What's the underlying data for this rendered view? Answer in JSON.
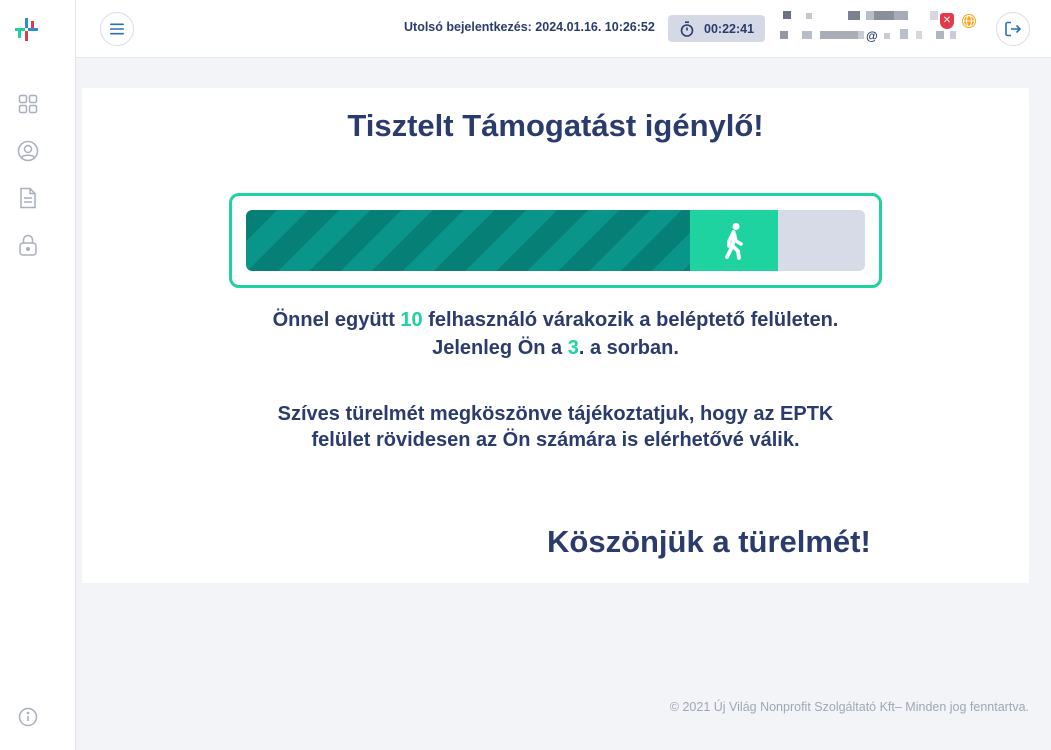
{
  "header": {
    "last_login_label": "Utolsó bejelentkezés: 2024.01.16. 10:26:52",
    "session_timer": "00:22:41",
    "user_email_separator": "@"
  },
  "sidebar": {
    "items": [
      {
        "icon": "dashboard-grid-icon"
      },
      {
        "icon": "user-profile-icon"
      },
      {
        "icon": "document-icon"
      },
      {
        "icon": "lock-icon"
      }
    ],
    "bottom_icon": "info-icon"
  },
  "main": {
    "title": "Tisztelt Támogatást igénylő!",
    "queue": {
      "progress_percent": 86,
      "line1_before": "Önnel együtt ",
      "waiting_count": "10",
      "line1_after": " felhasználó várakozik a beléptető felületen.",
      "line2_before": "Jelenleg Ön a ",
      "position": "3",
      "line2_after": ". a sorban."
    },
    "notice_line1": "Szíves türelmét megköszönve tájékoztatjuk, hogy az EPTK",
    "notice_line2": "felület rövidesen az Ön számára is elérhetővé válik.",
    "thanks": "Köszönjük a türelmét!"
  },
  "footer": {
    "copyright": "© 2021 Új Világ Nonprofit Szolgáltató Kft– Minden jog fenntartva."
  },
  "colors": {
    "accent": "#1ed3a0",
    "primary_text": "#2c3b6e",
    "progress_dark": "#067f76",
    "background": "#f3f4f8"
  }
}
